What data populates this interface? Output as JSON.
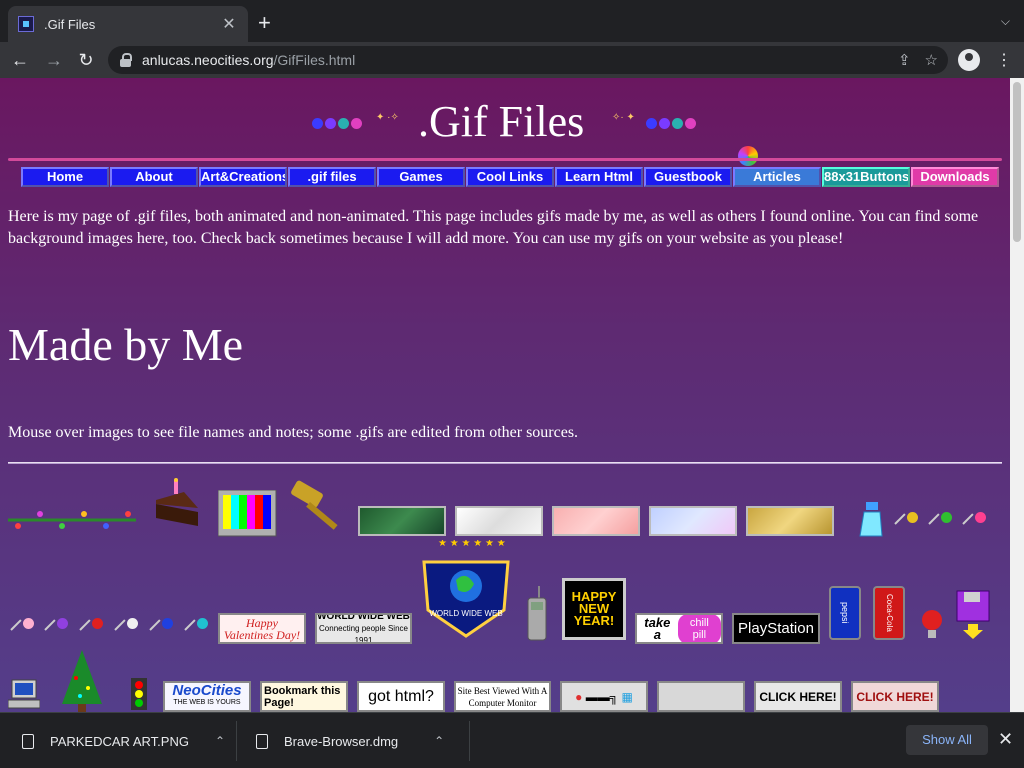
{
  "browser": {
    "tab_title": ".Gif Files",
    "url_host": "anlucas.neocities.org",
    "url_path": "/GifFiles.html"
  },
  "page": {
    "title": ".Gif Files",
    "nav": [
      "Home",
      "About",
      "Art&Creations",
      ".gif files",
      "Games",
      "Cool Links",
      "Learn Html",
      "Guestbook",
      "Articles",
      "88x31Buttons",
      "Downloads"
    ],
    "intro": "Here is my page of .gif files, both animated and non-animated. This page includes gifs made by me, as well as others I found online. You can find some background images here, too. Check back sometimes because I will add more. You can use my gifs on your website as you please!",
    "section_heading": "Made by Me",
    "note": "Mouse over images to see file names and notes; some .gifs are edited from other sources.",
    "gifs": {
      "valentines": "Happy Valentines Day!",
      "www_top": "WORLD WIDE WEB",
      "www_sub": "Connecting people Since 1991",
      "globe_badge": "WORLD WIDE WEB",
      "happy_new_year": "HAPPY NEW YEAR!",
      "take_a": "take a",
      "chill_pill": "chill pill",
      "playstation": "PlayStation",
      "pepsi": "pepsi",
      "coca_cola": "Coca-Cola",
      "neocities": "NeoCities",
      "neocities_sub": "THE WEB IS YOURS",
      "bookmark": "Bookmark this Page!",
      "got_html": "got html?",
      "best_viewed": "Site Best Viewed With A Computer Monitor",
      "click_here_1": "CLICK HERE!",
      "click_here_2": "CLICK HERE!"
    }
  },
  "downloads": {
    "items": [
      "PARKEDCAR ART.PNG",
      "Brave-Browser.dmg"
    ],
    "show_all": "Show All"
  }
}
